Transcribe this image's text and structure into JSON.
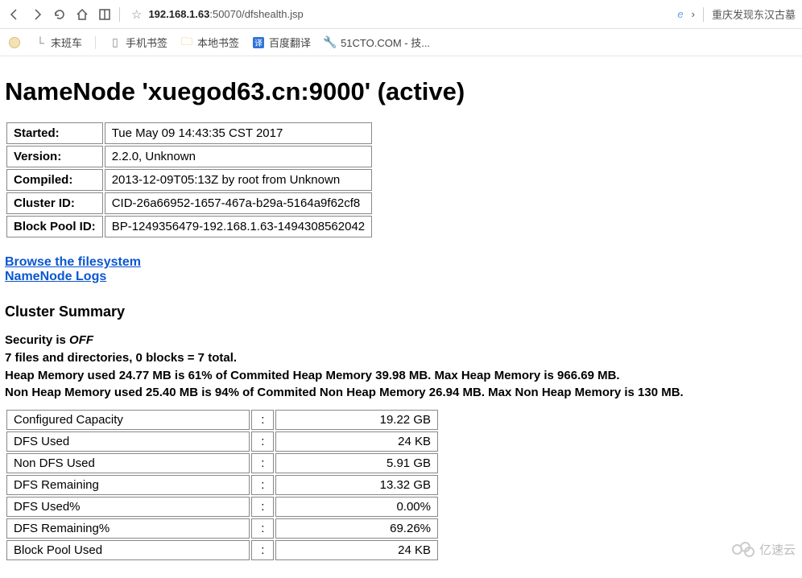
{
  "browser": {
    "url_host": "192.168.1.63",
    "url_port_path": ":50070/dfshealth.jsp",
    "right_text": "重庆发现东汉古墓"
  },
  "bookmarks": {
    "items": [
      {
        "label": "末班车"
      },
      {
        "label": "手机书签"
      },
      {
        "label": "本地书签"
      },
      {
        "label": "百度翻译"
      },
      {
        "label": "51CTO.COM - 技..."
      }
    ]
  },
  "page": {
    "title": "NameNode 'xuegod63.cn:9000' (active)"
  },
  "info_rows": [
    {
      "label": "Started:",
      "value": "Tue May 09 14:43:35 CST 2017"
    },
    {
      "label": "Version:",
      "value": "2.2.0, Unknown"
    },
    {
      "label": "Compiled:",
      "value": "2013-12-09T05:13Z by root from Unknown"
    },
    {
      "label": "Cluster ID:",
      "value": "CID-26a66952-1657-467a-b29a-5164a9f62cf8"
    },
    {
      "label": "Block Pool ID:",
      "value": "BP-1249356479-192.168.1.63-1494308562042"
    }
  ],
  "links": {
    "browse_fs": "Browse the filesystem",
    "logs": "NameNode Logs"
  },
  "section": {
    "title": "Cluster Summary"
  },
  "summary": {
    "security_prefix": "Security is ",
    "security_state": "OFF",
    "files_line": "7 files and directories, 0 blocks = 7 total.",
    "heap_line": "Heap Memory used 24.77 MB is 61% of Commited Heap Memory 39.98 MB. Max Heap Memory is 966.69 MB.",
    "nonheap_line": "Non Heap Memory used 25.40 MB is 94% of Commited Non Heap Memory 26.94 MB. Max Non Heap Memory is 130 MB."
  },
  "cluster_rows": [
    {
      "label": "Configured Capacity",
      "value": "19.22 GB"
    },
    {
      "label": "DFS Used",
      "value": "24 KB"
    },
    {
      "label": "Non DFS Used",
      "value": "5.91 GB"
    },
    {
      "label": "DFS Remaining",
      "value": "13.32 GB"
    },
    {
      "label": "DFS Used%",
      "value": "0.00%"
    },
    {
      "label": "DFS Remaining%",
      "value": "69.26%"
    },
    {
      "label": "Block Pool Used",
      "value": "24 KB"
    }
  ],
  "watermark": "亿速云"
}
